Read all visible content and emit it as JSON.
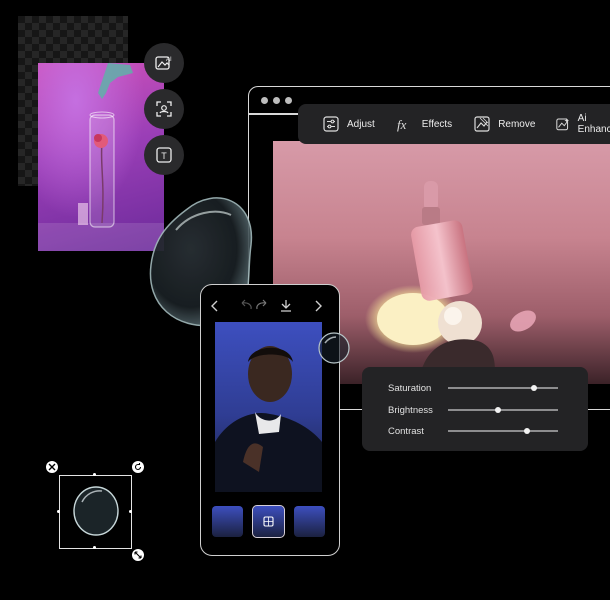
{
  "side_tools": [
    {
      "name": "ai-image-tool",
      "label": "AI"
    },
    {
      "name": "face-detect-tool",
      "label": ""
    },
    {
      "name": "text-tool",
      "label": "T"
    }
  ],
  "editor_toolbar": {
    "items": [
      {
        "name": "adjust",
        "label": "Adjust",
        "icon": "sliders-icon"
      },
      {
        "name": "effects",
        "label": "Effects",
        "icon": "fx-icon"
      },
      {
        "name": "remove",
        "label": "Remove",
        "icon": "image-remove-icon"
      },
      {
        "name": "ai-enhance",
        "label": "Ai Enhance",
        "icon": "ai-enhance-icon"
      }
    ]
  },
  "adjustments": [
    {
      "label": "Saturation",
      "value": 0.78
    },
    {
      "label": "Brightness",
      "value": 0.45
    },
    {
      "label": "Contrast",
      "value": 0.72
    }
  ],
  "phone": {
    "toolbar_icons": [
      "back-icon",
      "undo-icon",
      "redo-icon",
      "download-icon",
      "forward-icon"
    ],
    "thumbnails": 3,
    "selected_thumbnail": 1
  },
  "colors": {
    "background": "#000000",
    "panel": "#232325",
    "window_border": "#d8d8d8"
  }
}
